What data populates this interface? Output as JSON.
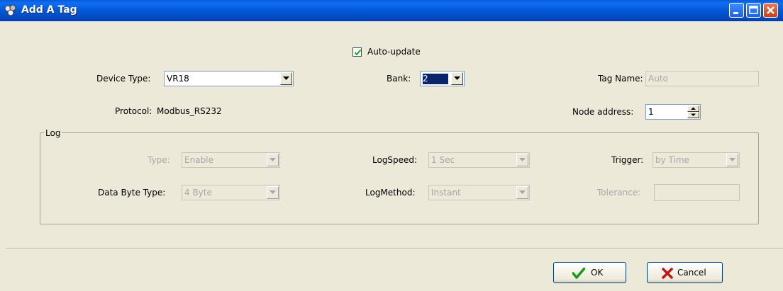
{
  "window": {
    "title": "Add A Tag"
  },
  "auto_update": {
    "label": "Auto-update",
    "checked": true
  },
  "device_type": {
    "label": "Device Type:",
    "value": "VR18"
  },
  "bank": {
    "label": "Bank:",
    "value": "2"
  },
  "tag_name": {
    "label": "Tag Name:",
    "value": "Auto"
  },
  "protocol": {
    "label": "Protocol:",
    "value": "Modbus_RS232"
  },
  "node_address": {
    "label": "Node address:",
    "value": "1"
  },
  "log": {
    "legend": "Log",
    "type": {
      "label": "Type:",
      "value": "Enable"
    },
    "log_speed": {
      "label": "LogSpeed:",
      "value": "1 Sec"
    },
    "trigger": {
      "label": "Trigger:",
      "value": "by Time"
    },
    "data_byte_type": {
      "label": "Data Byte Type:",
      "value": "4 Byte"
    },
    "log_method": {
      "label": "LogMethod:",
      "value": "Instant"
    },
    "tolerance": {
      "label": "Tolerance:",
      "value": ""
    }
  },
  "buttons": {
    "ok": "OK",
    "cancel": "Cancel"
  },
  "colors": {
    "titlebar": "#0358d6",
    "dialog_bg": "#ece9d8",
    "ok_icon": "#1a9a1a",
    "cancel_icon": "#c0181a"
  },
  "icons": {
    "app": "app-logo-icon",
    "ok": "checkmark-icon",
    "cancel": "x-icon"
  }
}
